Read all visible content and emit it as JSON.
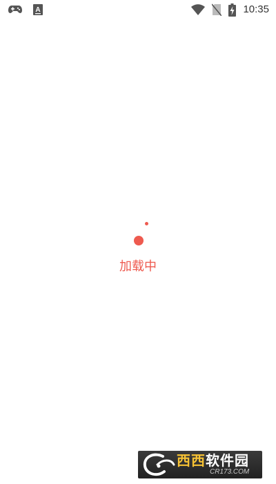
{
  "status_bar": {
    "time": "10:35",
    "left_icons": [
      "gamepad-icon",
      "keyboard-a-icon"
    ],
    "right_icons": [
      "wifi-icon",
      "no-sim-icon",
      "battery-charging-icon"
    ]
  },
  "loader": {
    "text": "加载中",
    "color": "#ee5a4f"
  },
  "watermark": {
    "title_part1": "西西",
    "title_part2": "软件园",
    "subtitle": "CR173.COM"
  }
}
